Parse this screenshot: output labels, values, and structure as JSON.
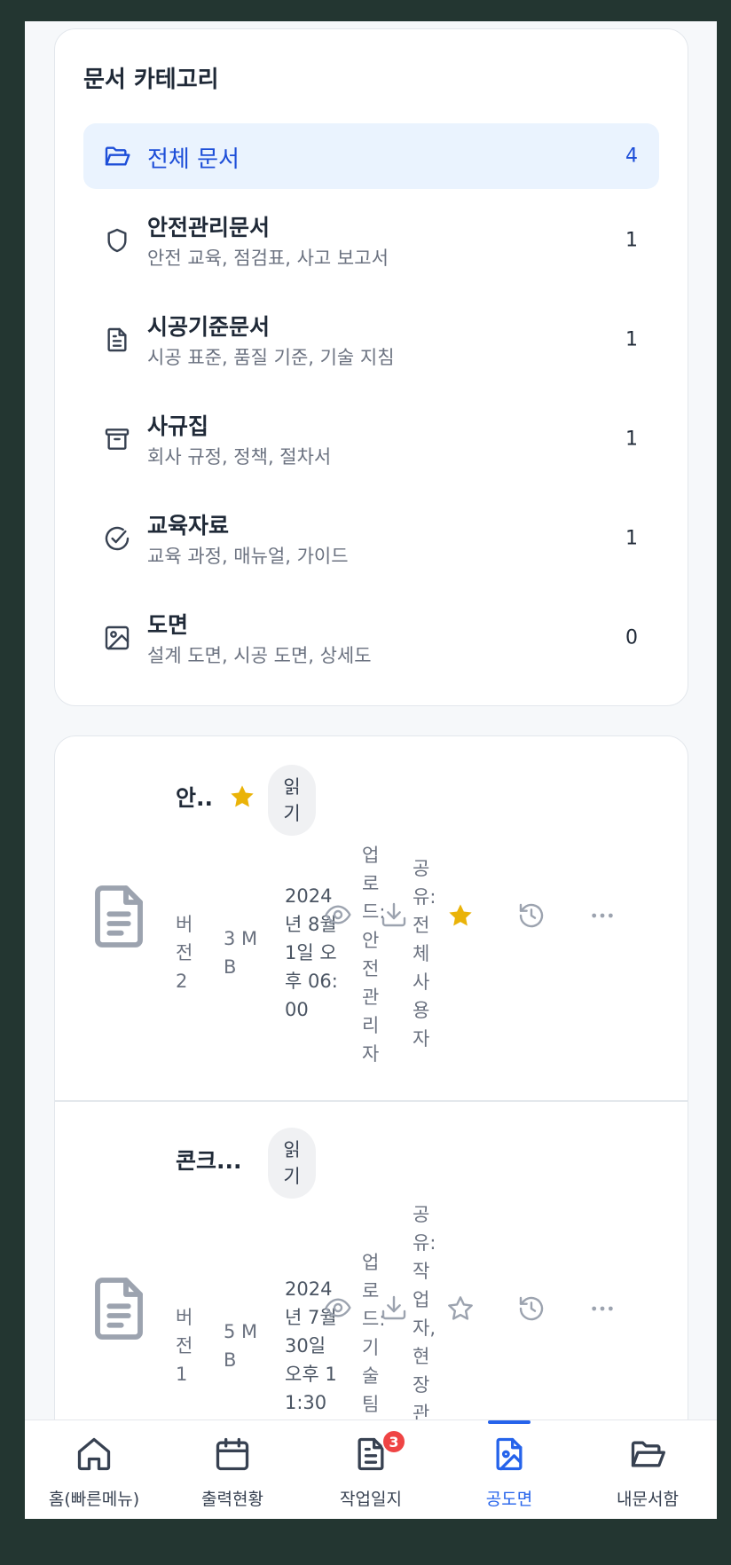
{
  "categories": {
    "title": "문서 카테고리",
    "all": {
      "label": "전체 문서",
      "count": "4"
    },
    "items": [
      {
        "name": "안전관리문서",
        "desc": "안전 교육, 점검표, 사고 보고서",
        "count": "1",
        "icon": "shield-icon"
      },
      {
        "name": "시공기준문서",
        "desc": "시공 표준, 품질 기준, 기술 지침",
        "count": "1",
        "icon": "file-text-icon"
      },
      {
        "name": "사규집",
        "desc": "회사 규정, 정책, 절차서",
        "count": "1",
        "icon": "archive-icon"
      },
      {
        "name": "교육자료",
        "desc": "교육 과정, 매뉴얼, 가이드",
        "count": "1",
        "icon": "check-circle-icon"
      },
      {
        "name": "도면",
        "desc": "설계 도면, 시공 도면, 상세도",
        "count": "0",
        "icon": "image-icon"
      }
    ]
  },
  "documents": [
    {
      "title": "안..",
      "permission": "읽기",
      "version": "버전 2",
      "size": "3 MB",
      "date": "2024년 8월 1일 오후 06:00",
      "uploader": "업로드: 안전관리자",
      "shared": "공유: 전체 사용자",
      "favorite": true
    },
    {
      "title": "콘크...",
      "permission": "읽기",
      "version": "버전 1",
      "size": "5 MB",
      "date": "2024년 7월 30일 오후 11:30",
      "uploader": "업로드: 기술팀",
      "shared": "공유: 작업자, 현장관리자",
      "favorite": false
    }
  ],
  "nav": {
    "items": [
      {
        "label": "홈(빠른메뉴)",
        "icon": "home-icon"
      },
      {
        "label": "출력현황",
        "icon": "calendar-icon"
      },
      {
        "label": "작업일지",
        "icon": "clipboard-icon",
        "badge": "3"
      },
      {
        "label": "공도면",
        "icon": "blueprint-icon",
        "active": true
      },
      {
        "label": "내문서함",
        "icon": "folder-icon"
      }
    ]
  },
  "colors": {
    "accent": "#2563eb",
    "star": "#eab308",
    "badge": "#ef4444"
  }
}
